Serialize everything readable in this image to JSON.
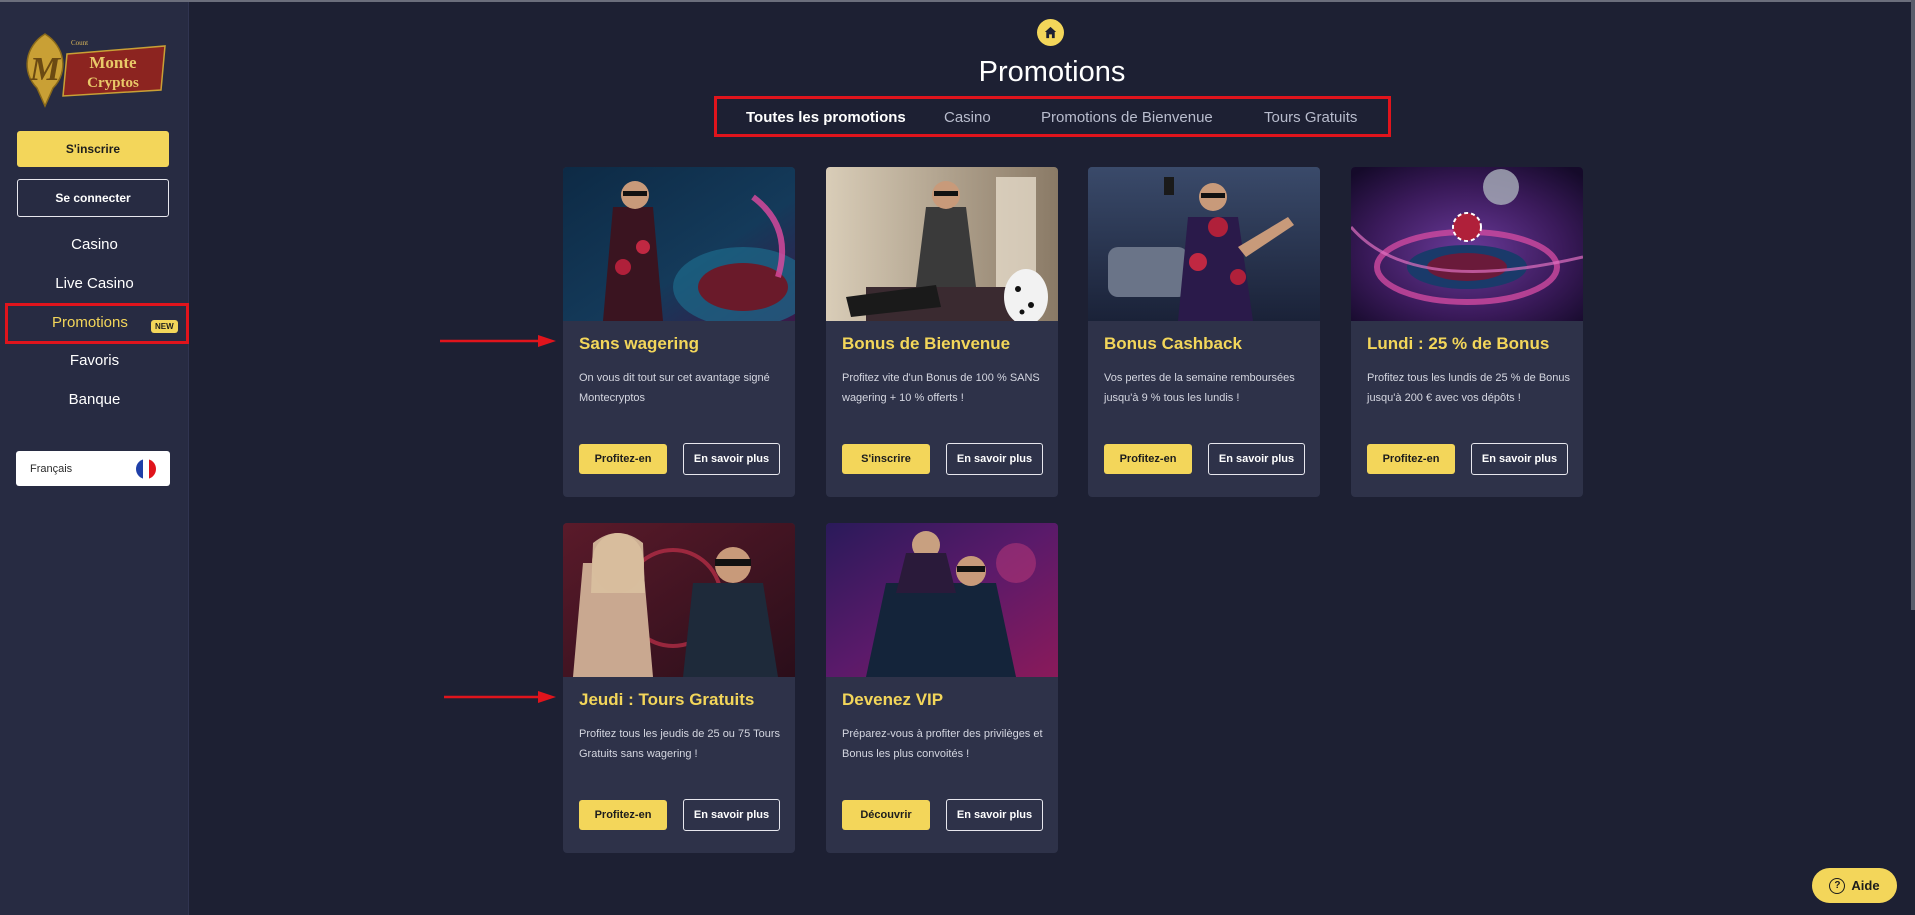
{
  "sidebar": {
    "logo": {
      "top": "Count",
      "line1": "Monte",
      "line2": "Cryptos"
    },
    "signup_label": "S'inscrire",
    "login_label": "Se connecter",
    "nav": [
      {
        "label": "Casino"
      },
      {
        "label": "Live Casino"
      },
      {
        "label": "Promotions",
        "badge": "NEW",
        "active": true
      },
      {
        "label": "Favoris"
      },
      {
        "label": "Banque"
      }
    ],
    "language": {
      "label": "Français",
      "flag_colors": [
        "#1f3fa8",
        "#ffffff",
        "#e0141c"
      ]
    }
  },
  "header": {
    "home_icon": "home-icon",
    "title": "Promotions",
    "tabs": [
      {
        "label": "Toutes les promotions",
        "active": true
      },
      {
        "label": "Casino"
      },
      {
        "label": "Promotions de Bienvenue"
      },
      {
        "label": "Tours Gratuits"
      }
    ]
  },
  "cards": [
    {
      "title": "Sans wagering",
      "description": "On vous dit tout sur cet avantage signé Montecryptos",
      "primary": "Profitez-en",
      "secondary": "En savoir plus"
    },
    {
      "title": "Bonus de Bienvenue",
      "description": "Profitez vite d'un Bonus de 100 % SANS wagering + 10 % offerts !",
      "primary": "S'inscrire",
      "secondary": "En savoir plus"
    },
    {
      "title": "Bonus Cashback",
      "description": "Vos pertes de la semaine remboursées jusqu'à 9 % tous les lundis !",
      "primary": "Profitez-en",
      "secondary": "En savoir plus"
    },
    {
      "title": "Lundi : 25 % de Bonus",
      "description": "Profitez tous les lundis de 25 % de Bonus jusqu'à 200 € avec vos dépôts !",
      "primary": "Profitez-en",
      "secondary": "En savoir plus"
    },
    {
      "title": "Jeudi : Tours Gratuits",
      "description": "Profitez tous les jeudis de 25 ou 75 Tours Gratuits sans wagering !",
      "primary": "Profitez-en",
      "secondary": "En savoir plus"
    },
    {
      "title": "Devenez VIP",
      "description": "Préparez-vous à profiter des privilèges et Bonus les plus convoités !",
      "primary": "Découvrir",
      "secondary": "En savoir plus"
    }
  ],
  "help": {
    "label": "Aide",
    "icon": "question-icon"
  },
  "colors": {
    "accent": "#f3d65a",
    "highlight": "#e0141c",
    "background": "#1d2033",
    "card": "#2e3249"
  }
}
